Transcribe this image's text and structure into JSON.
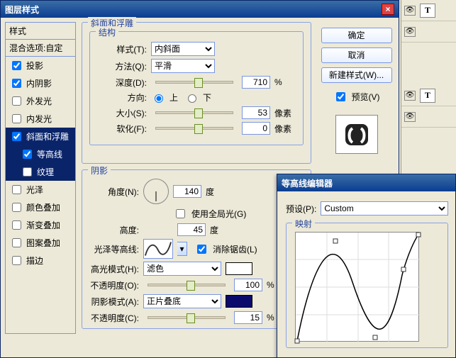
{
  "window": {
    "title": "图层样式"
  },
  "left": {
    "header": "样式",
    "blend": "混合选项:自定",
    "items": [
      {
        "label": "投影",
        "checked": true,
        "selected": false,
        "indent": false
      },
      {
        "label": "内阴影",
        "checked": true,
        "selected": false,
        "indent": false
      },
      {
        "label": "外发光",
        "checked": false,
        "selected": false,
        "indent": false
      },
      {
        "label": "内发光",
        "checked": false,
        "selected": false,
        "indent": false
      },
      {
        "label": "斜面和浮雕",
        "checked": true,
        "selected": true,
        "indent": false
      },
      {
        "label": "等高线",
        "checked": true,
        "selected": true,
        "indent": true
      },
      {
        "label": "纹理",
        "checked": false,
        "selected": true,
        "indent": true
      },
      {
        "label": "光泽",
        "checked": false,
        "selected": false,
        "indent": false
      },
      {
        "label": "颜色叠加",
        "checked": false,
        "selected": false,
        "indent": false
      },
      {
        "label": "渐变叠加",
        "checked": false,
        "selected": false,
        "indent": false
      },
      {
        "label": "图案叠加",
        "checked": false,
        "selected": false,
        "indent": false
      },
      {
        "label": "描边",
        "checked": false,
        "selected": false,
        "indent": false
      }
    ]
  },
  "bevel": {
    "group_title": "斜面和浮雕",
    "structure_title": "结构",
    "style_label": "样式(T):",
    "style_value": "内斜面",
    "technique_label": "方法(Q):",
    "technique_value": "平滑",
    "depth_label": "深度(D):",
    "depth_value": "710",
    "depth_unit": "%",
    "direction_label": "方向:",
    "up": "上",
    "down": "下",
    "dir_value": "up",
    "size_label": "大小(S):",
    "size_value": "53",
    "size_unit": "像素",
    "soften_label": "软化(F):",
    "soften_value": "0",
    "soften_unit": "像素"
  },
  "shading": {
    "group_title": "阴影",
    "angle_label": "角度(N):",
    "angle_value": "140",
    "angle_unit": "度",
    "global_label": "使用全局光(G)",
    "global_checked": false,
    "altitude_label": "高度:",
    "altitude_value": "45",
    "altitude_unit": "度",
    "gloss_label": "光泽等高线:",
    "antialias_label": "消除锯齿(L)",
    "antialias_checked": true,
    "hmode_label": "高光模式(H):",
    "hmode_value": "滤色",
    "hcolor": "#ffffff",
    "hopacity_label": "不透明度(O):",
    "hopacity_value": "100",
    "pct": "%",
    "smode_label": "阴影模式(A):",
    "smode_value": "正片叠底",
    "scolor": "#0a0a6c",
    "sopacity_label": "不透明度(C):",
    "sopacity_value": "15"
  },
  "right": {
    "ok": "确定",
    "cancel": "取消",
    "newstyle": "新建样式(W)...",
    "preview_label": "预览(V)",
    "preview_checked": true
  },
  "contour_editor": {
    "title": "等高线编辑器",
    "preset_label": "预设(P):",
    "preset_value": "Custom",
    "mapping_label": "映射"
  },
  "layers": {
    "rows": [
      {
        "t": "T"
      },
      {
        "t": ""
      },
      {
        "t": "T"
      },
      {
        "t": ""
      }
    ]
  }
}
